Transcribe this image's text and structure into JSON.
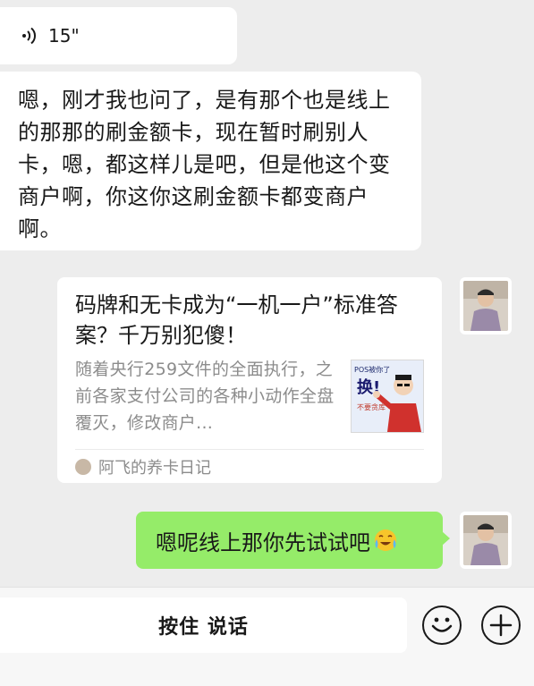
{
  "messages": {
    "voice": {
      "duration": "15\""
    },
    "text": "嗯，刚才我也问了，是有那个也是线上的那那的刷金额卡，现在暂时刷别人卡，嗯，都这样儿是吧，但是他这个变商户啊，你这你这刷金额卡都变商户啊。",
    "link_card": {
      "title": "码牌和无卡成为“一机一户”标准答案？千万别犯傻！",
      "description": "随着央行259文件的全面执行，之前各家支付公司的各种小动作全盘覆灭，修改商户...",
      "source": "阿飞的养卡日记",
      "thumbnail_caption_top": "POS被你了",
      "thumbnail_caption_big": "换!",
      "thumbnail_caption_bottom": "不要贪库"
    },
    "sent": {
      "text": "嗯呢线上那你先试试吧"
    }
  },
  "input_bar": {
    "hold_to_talk_label": "按住 说话",
    "emoji_icon": "smiley-icon",
    "plus_icon": "plus-circle-icon"
  },
  "colors": {
    "sent_bubble": "#95ec69",
    "received_bubble": "#ffffff",
    "background": "#ededed"
  }
}
